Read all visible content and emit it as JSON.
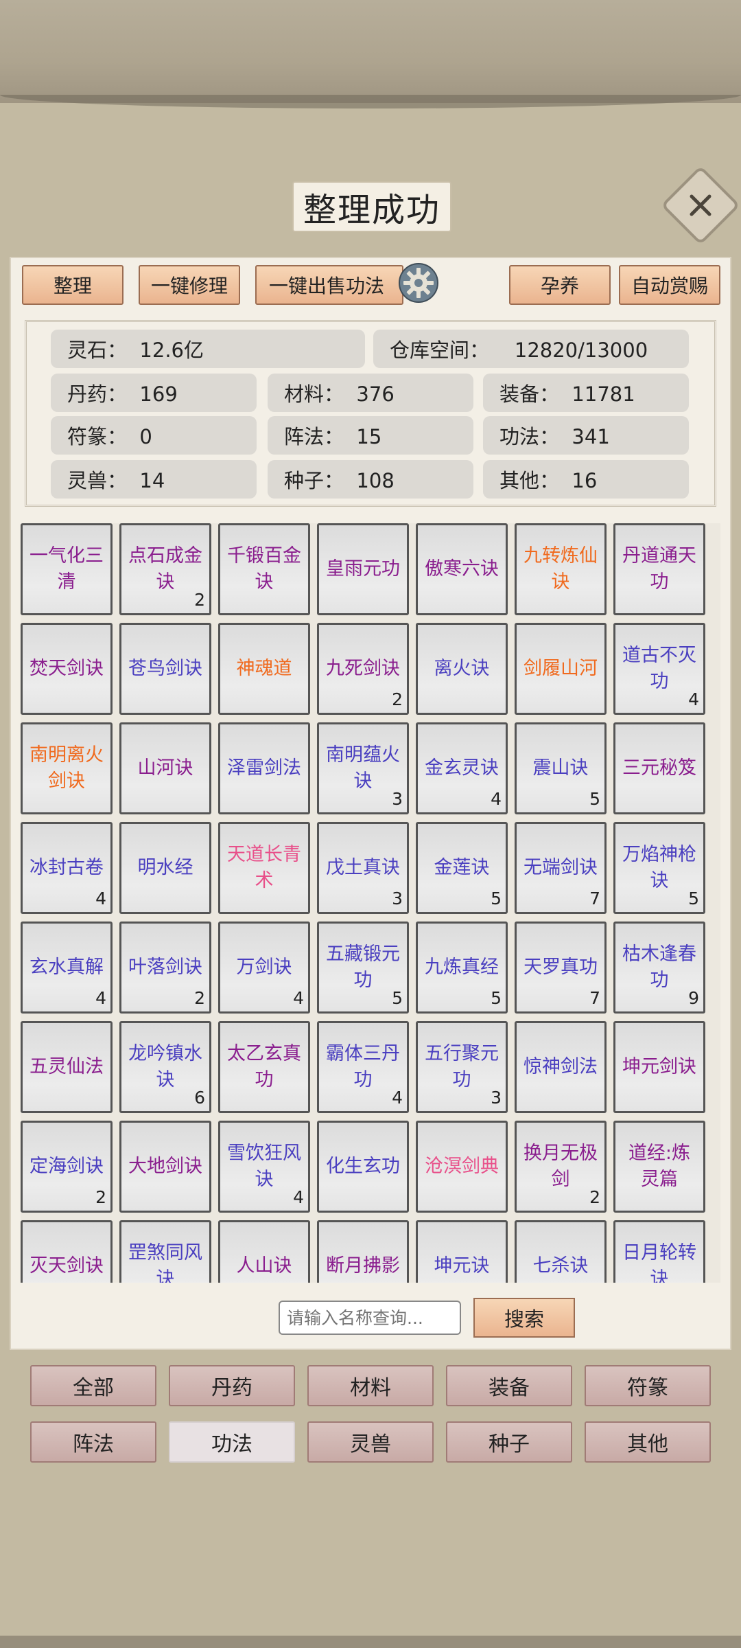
{
  "toast": "整理成功",
  "toolbar": {
    "sort": "整理",
    "repair": "一键修理",
    "sell": "一键出售功法",
    "nurture": "孕养",
    "auto_reward": "自动赏赐"
  },
  "stats": {
    "spirit_stone": "灵石：  12.6亿",
    "storage": "仓库空间：    12820/13000",
    "pills": "丹药：  169",
    "materials": "材料：  376",
    "equipment": "装备：  11781",
    "talismans": "符篆：  0",
    "formations": "阵法：  15",
    "techniques": "功法：  341",
    "beasts": "灵兽：  14",
    "seeds": "种子：  108",
    "others": "其他：  16"
  },
  "items": [
    {
      "name": "一气化三清",
      "count": "",
      "color": "#8a1e8e"
    },
    {
      "name": "点石成金诀",
      "count": "2",
      "color": "#8a1e8e"
    },
    {
      "name": "千锻百金诀",
      "count": "",
      "color": "#8a1e8e"
    },
    {
      "name": "皇雨元功",
      "count": "",
      "color": "#8a1e8e"
    },
    {
      "name": "傲寒六诀",
      "count": "",
      "color": "#8a1e8e"
    },
    {
      "name": "九转炼仙诀",
      "count": "",
      "color": "#f06a1e"
    },
    {
      "name": "丹道通天功",
      "count": "",
      "color": "#8a1e8e"
    },
    {
      "name": "焚天剑诀",
      "count": "",
      "color": "#8a1e8e"
    },
    {
      "name": "苍鸟剑诀",
      "count": "",
      "color": "#4a3fc0"
    },
    {
      "name": "神魂道",
      "count": "",
      "color": "#f06a1e"
    },
    {
      "name": "九死剑诀",
      "count": "2",
      "color": "#8a1e8e"
    },
    {
      "name": "离火诀",
      "count": "",
      "color": "#4a3fc0"
    },
    {
      "name": "剑履山河",
      "count": "",
      "color": "#f06a1e"
    },
    {
      "name": "道古不灭功",
      "count": "4",
      "color": "#4a3fc0"
    },
    {
      "name": "南明离火剑诀",
      "count": "",
      "color": "#f06a1e"
    },
    {
      "name": "山河诀",
      "count": "",
      "color": "#8a1e8e"
    },
    {
      "name": "泽雷剑法",
      "count": "",
      "color": "#4a3fc0"
    },
    {
      "name": "南明蕴火诀",
      "count": "3",
      "color": "#4a3fc0"
    },
    {
      "name": "金玄灵诀",
      "count": "4",
      "color": "#4a3fc0"
    },
    {
      "name": "震山诀",
      "count": "5",
      "color": "#4a3fc0"
    },
    {
      "name": "三元秘笈",
      "count": "",
      "color": "#8a1e8e"
    },
    {
      "name": "冰封古卷",
      "count": "4",
      "color": "#4a3fc0"
    },
    {
      "name": "明水经",
      "count": "",
      "color": "#4a3fc0"
    },
    {
      "name": "天道长青术",
      "count": "",
      "color": "#e8508a"
    },
    {
      "name": "戊土真诀",
      "count": "3",
      "color": "#4a3fc0"
    },
    {
      "name": "金莲诀",
      "count": "5",
      "color": "#4a3fc0"
    },
    {
      "name": "无端剑诀",
      "count": "7",
      "color": "#4a3fc0"
    },
    {
      "name": "万焰神枪诀",
      "count": "5",
      "color": "#4a3fc0"
    },
    {
      "name": "玄水真解",
      "count": "4",
      "color": "#4a3fc0"
    },
    {
      "name": "叶落剑诀",
      "count": "2",
      "color": "#4a3fc0"
    },
    {
      "name": "万剑诀",
      "count": "4",
      "color": "#4a3fc0"
    },
    {
      "name": "五藏锻元功",
      "count": "5",
      "color": "#4a3fc0"
    },
    {
      "name": "九炼真经",
      "count": "5",
      "color": "#4a3fc0"
    },
    {
      "name": "天罗真功",
      "count": "7",
      "color": "#4a3fc0"
    },
    {
      "name": "枯木逢春功",
      "count": "9",
      "color": "#4a3fc0"
    },
    {
      "name": "五灵仙法",
      "count": "",
      "color": "#8a1e8e"
    },
    {
      "name": "龙吟镇水诀",
      "count": "6",
      "color": "#4a3fc0"
    },
    {
      "name": "太乙玄真功",
      "count": "",
      "color": "#8a1e8e"
    },
    {
      "name": "霸体三丹功",
      "count": "4",
      "color": "#4a3fc0"
    },
    {
      "name": "五行聚元功",
      "count": "3",
      "color": "#4a3fc0"
    },
    {
      "name": "惊神剑法",
      "count": "",
      "color": "#4a3fc0"
    },
    {
      "name": "坤元剑诀",
      "count": "",
      "color": "#8a1e8e"
    },
    {
      "name": "定海剑诀",
      "count": "2",
      "color": "#4a3fc0"
    },
    {
      "name": "大地剑诀",
      "count": "",
      "color": "#8a1e8e"
    },
    {
      "name": "雪饮狂风诀",
      "count": "4",
      "color": "#4a3fc0"
    },
    {
      "name": "化生玄功",
      "count": "",
      "color": "#4a3fc0"
    },
    {
      "name": "沧溟剑典",
      "count": "",
      "color": "#e8508a"
    },
    {
      "name": "换月无极剑",
      "count": "2",
      "color": "#8a1e8e"
    },
    {
      "name": "道经:炼灵篇",
      "count": "",
      "color": "#8a1e8e"
    },
    {
      "name": "灭天剑诀",
      "count": "",
      "color": "#8a1e8e"
    },
    {
      "name": "罡煞同风诀",
      "count": "",
      "color": "#4a3fc0"
    },
    {
      "name": "人山诀",
      "count": "",
      "color": "#8a1e8e"
    },
    {
      "name": "断月拂影",
      "count": "",
      "color": "#8a1e8e"
    },
    {
      "name": "坤元诀",
      "count": "",
      "color": "#4a3fc0"
    },
    {
      "name": "七杀诀",
      "count": "",
      "color": "#4a3fc0"
    },
    {
      "name": "日月轮转诀",
      "count": "",
      "color": "#4a3fc0"
    }
  ],
  "search": {
    "placeholder": "请输入名称查询...",
    "button": "搜索"
  },
  "tabs": [
    "全部",
    "丹药",
    "材料",
    "装备",
    "符篆",
    "阵法",
    "功法",
    "灵兽",
    "种子",
    "其他"
  ],
  "active_tab": "功法"
}
